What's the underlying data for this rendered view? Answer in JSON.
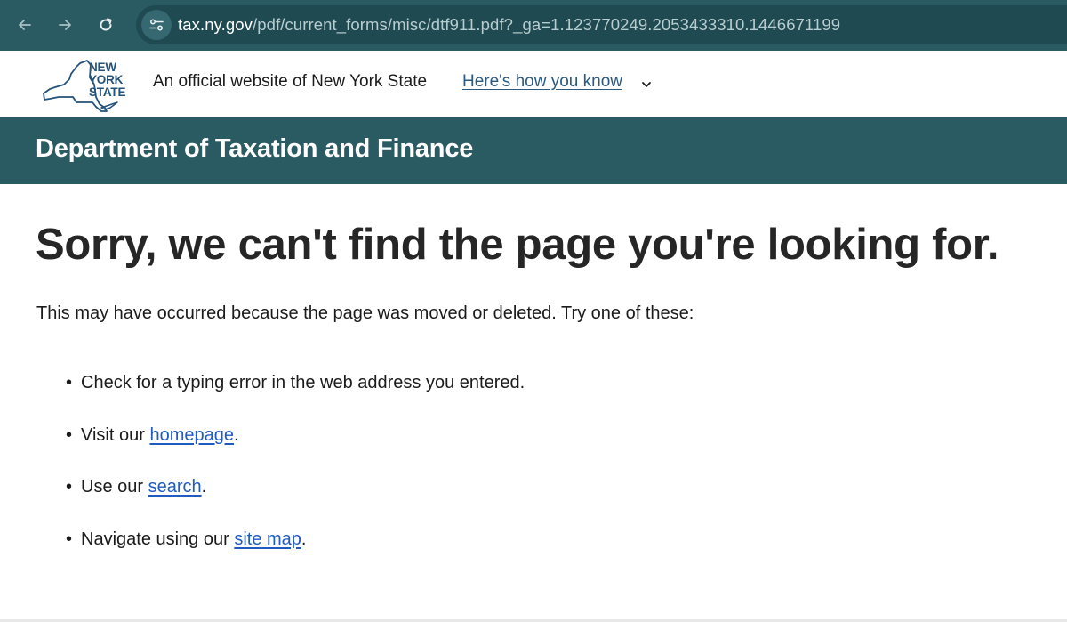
{
  "browser": {
    "url_domain": "tax.ny.gov",
    "url_path": "/pdf/current_forms/misc/dtf911.pdf?_ga=1.123770249.2053433310.1446671199",
    "icons": [
      "back-arrow-icon",
      "forward-arrow-icon",
      "reload-icon",
      "site-info-icon"
    ],
    "toolbar_color": "#2a5a62"
  },
  "banner": {
    "logo_lines": [
      "NEW",
      "YORK",
      "STATE"
    ],
    "official_text": "An official website of New York State",
    "how_you_know": "Here's how you know"
  },
  "agency": {
    "title": "Department of Taxation and Finance",
    "color": "#2a5a62"
  },
  "main": {
    "heading": "Sorry, we can't find the page you're looking for.",
    "intro": "This may have occurred because the page was moved or deleted. Try one of these:",
    "bullet": "•",
    "suggestions": [
      {
        "text": "Check for a typing error in the web address you entered."
      },
      {
        "prefix": "Visit our ",
        "link": "homepage",
        "suffix": "."
      },
      {
        "prefix": "Use our ",
        "link": "search",
        "suffix": "."
      },
      {
        "prefix": "Navigate using our ",
        "link": "site map",
        "suffix": "."
      }
    ],
    "link_color": "#1f5bc0"
  }
}
